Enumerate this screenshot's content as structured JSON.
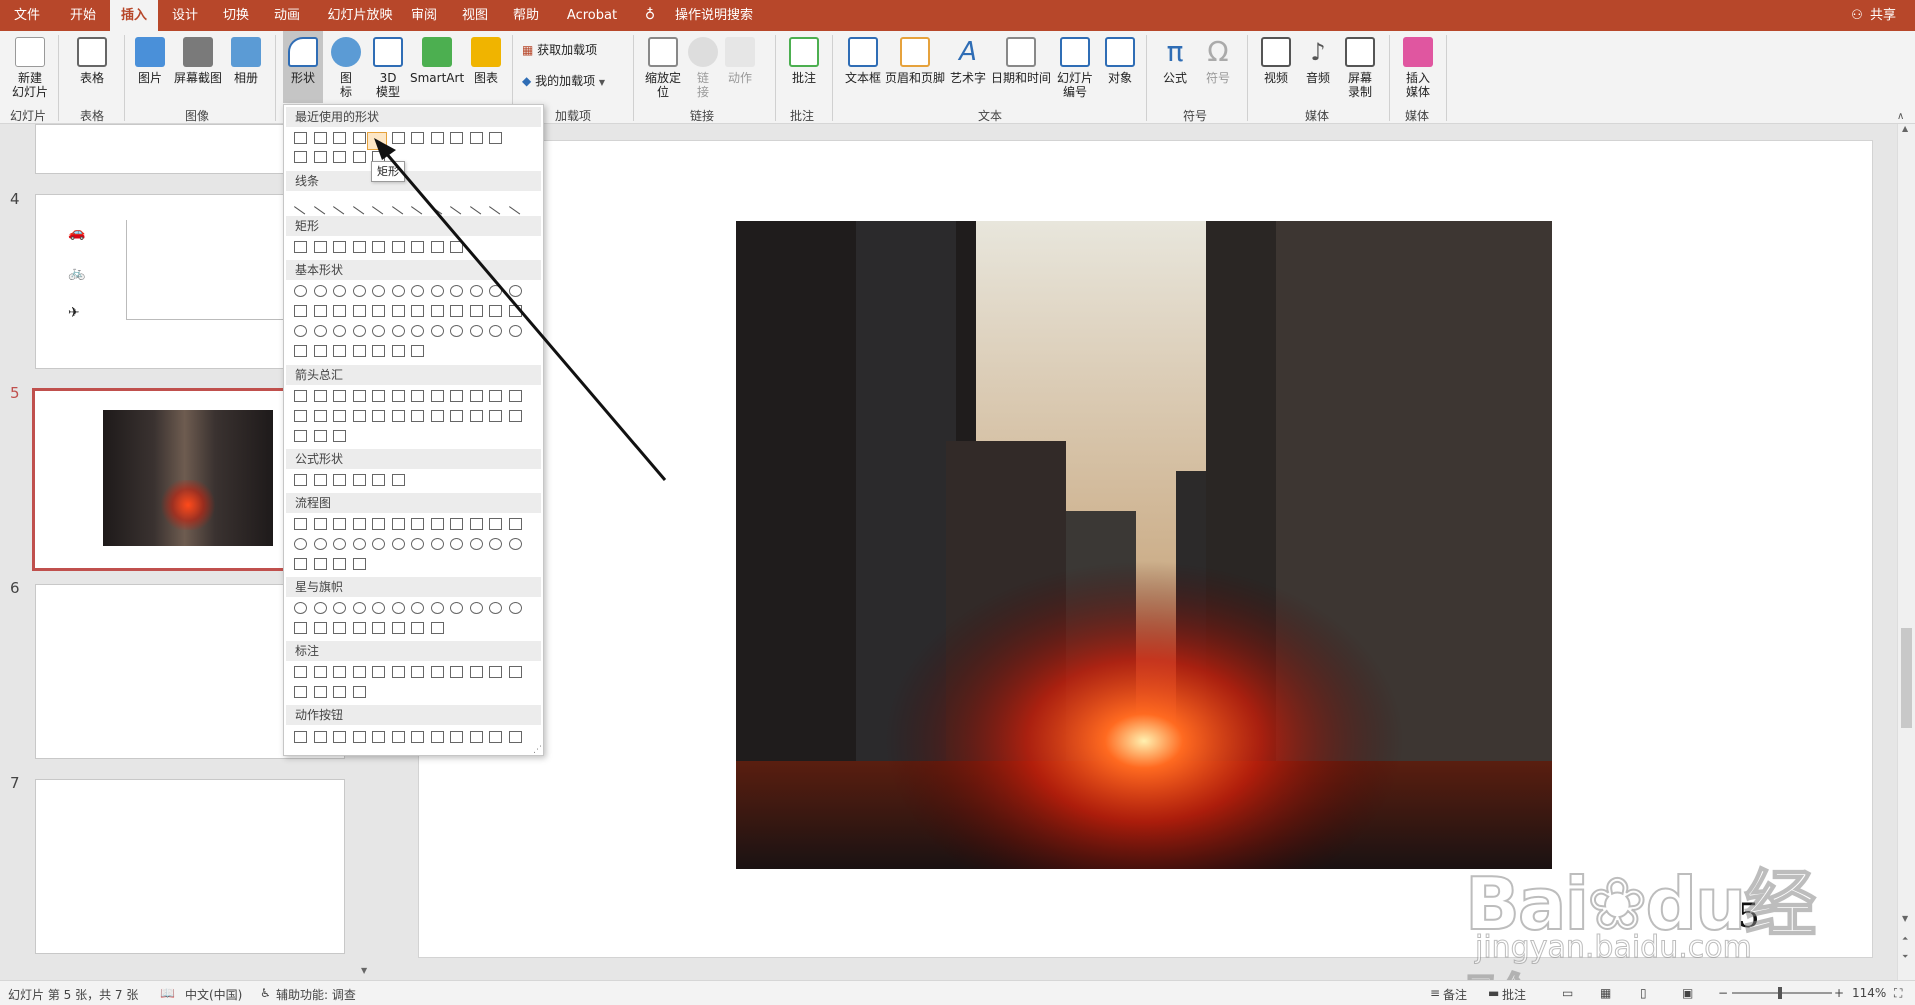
{
  "tabs": [
    "文件",
    "开始",
    "插入",
    "设计",
    "切换",
    "动画",
    "幻灯片放映",
    "审阅",
    "视图",
    "帮助",
    "Acrobat",
    "操作说明搜索"
  ],
  "active_tab": "插入",
  "share_label": "共享",
  "ribbon": {
    "new_slide": "新建\n幻灯片",
    "table": "表格",
    "picture": "图片",
    "screenshot": "屏幕截图",
    "album": "相册",
    "shapes": "形状",
    "icons": "图\n标",
    "model3d": "3D\n模型",
    "smartart": "SmartArt",
    "chart": "图表",
    "get_addins": "获取加载项",
    "my_addins": "我的加载项",
    "zoom": "缩放定\n位",
    "link": "链\n接",
    "action": "动作",
    "comment": "批注",
    "textbox": "文本框",
    "header_footer": "页眉和页脚",
    "wordart": "艺术字",
    "datetime": "日期和时间",
    "slide_number": "幻灯片\n编号",
    "object": "对象",
    "equation": "公式",
    "symbol": "符号",
    "video": "视频",
    "audio": "音频",
    "screen_record": "屏幕\n录制",
    "insert_media": "插入\n媒体",
    "groups": {
      "slides": "幻灯片",
      "tables": "表格",
      "images": "图像",
      "addins": "加载项",
      "links": "链接",
      "comments": "批注",
      "text": "文本",
      "symbols": "符号",
      "media": "媒体",
      "media2": "媒体"
    }
  },
  "thumbnails": {
    "numbers": [
      "4",
      "5",
      "6",
      "7"
    ]
  },
  "shapes_menu": {
    "recent": "最近使用的形状",
    "lines": "线条",
    "rect": "矩形",
    "basic": "基本形状",
    "arrows": "箭头总汇",
    "equation": "公式形状",
    "flowchart": "流程图",
    "stars": "星与旗帜",
    "callouts": "标注",
    "action_buttons": "动作按钮",
    "tooltip": "矩形"
  },
  "slide_page_number": "5",
  "status": {
    "slide_info": "幻灯片 第 5 张，共 7 张",
    "language": "中文(中国)",
    "accessibility": "辅助功能: 调查",
    "notes": "备注",
    "comments": "批注",
    "zoom": "114%"
  },
  "watermark": {
    "text1": "Bai",
    "text2": "du",
    "text3": "经验",
    "url": "jingyan.baidu.com"
  },
  "colors": {
    "accent": "#b7472a",
    "selected_border": "#c0504d"
  }
}
